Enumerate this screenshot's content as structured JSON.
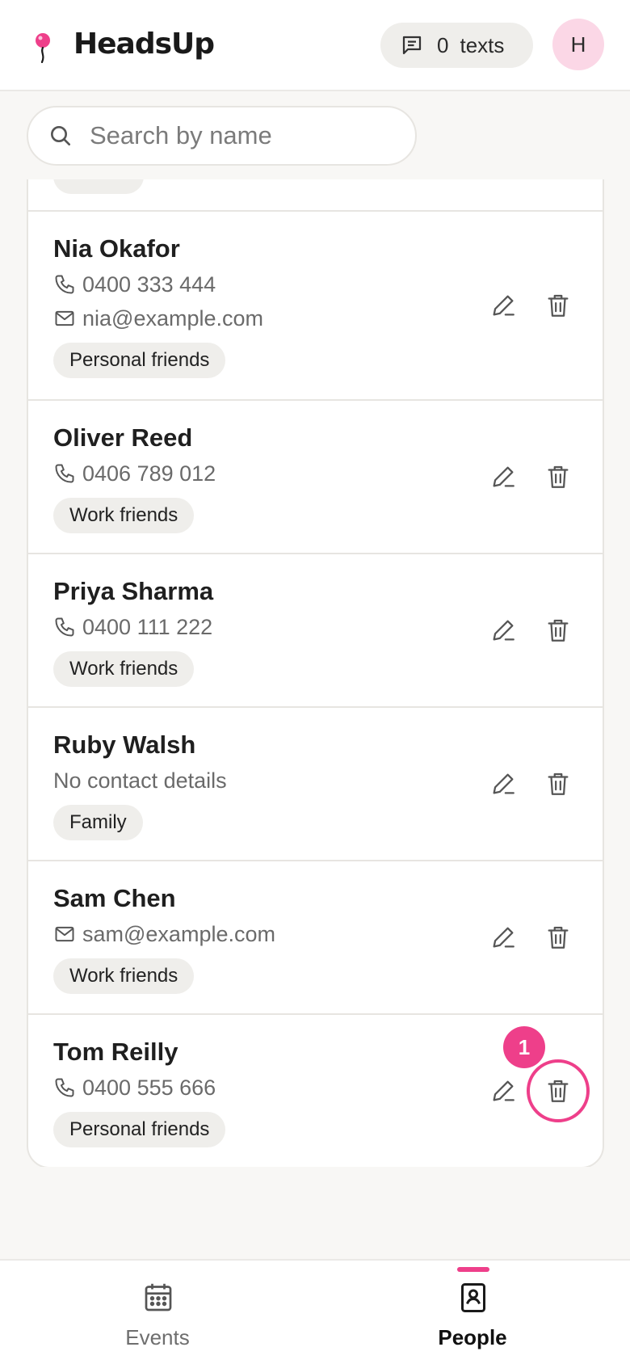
{
  "app": {
    "brand": "HeadsUp",
    "accent_color": "#ee3f8a",
    "texts_count": "0",
    "texts_label": "texts",
    "avatar_initial": "H"
  },
  "search": {
    "placeholder": "Search by name",
    "value": ""
  },
  "people": [
    {
      "name": "Nia Okafor",
      "phone": "0400 333 444",
      "email": "nia@example.com",
      "group": "Personal friends"
    },
    {
      "name": "Oliver Reed",
      "phone": "0406 789 012",
      "group": "Work friends"
    },
    {
      "name": "Priya Sharma",
      "phone": "0400 111 222",
      "group": "Work friends"
    },
    {
      "name": "Ruby Walsh",
      "no_details": "No contact details",
      "group": "Family"
    },
    {
      "name": "Sam Chen",
      "email": "sam@example.com",
      "group": "Work friends"
    },
    {
      "name": "Tom Reilly",
      "phone": "0400 555 666",
      "group": "Personal friends"
    }
  ],
  "annotation": {
    "step_number": "1",
    "target": "delete-button-tom-reilly"
  },
  "nav": {
    "items": [
      {
        "label": "Events",
        "icon": "calendar-icon",
        "active": false
      },
      {
        "label": "People",
        "icon": "contact-book-icon",
        "active": true
      }
    ]
  }
}
